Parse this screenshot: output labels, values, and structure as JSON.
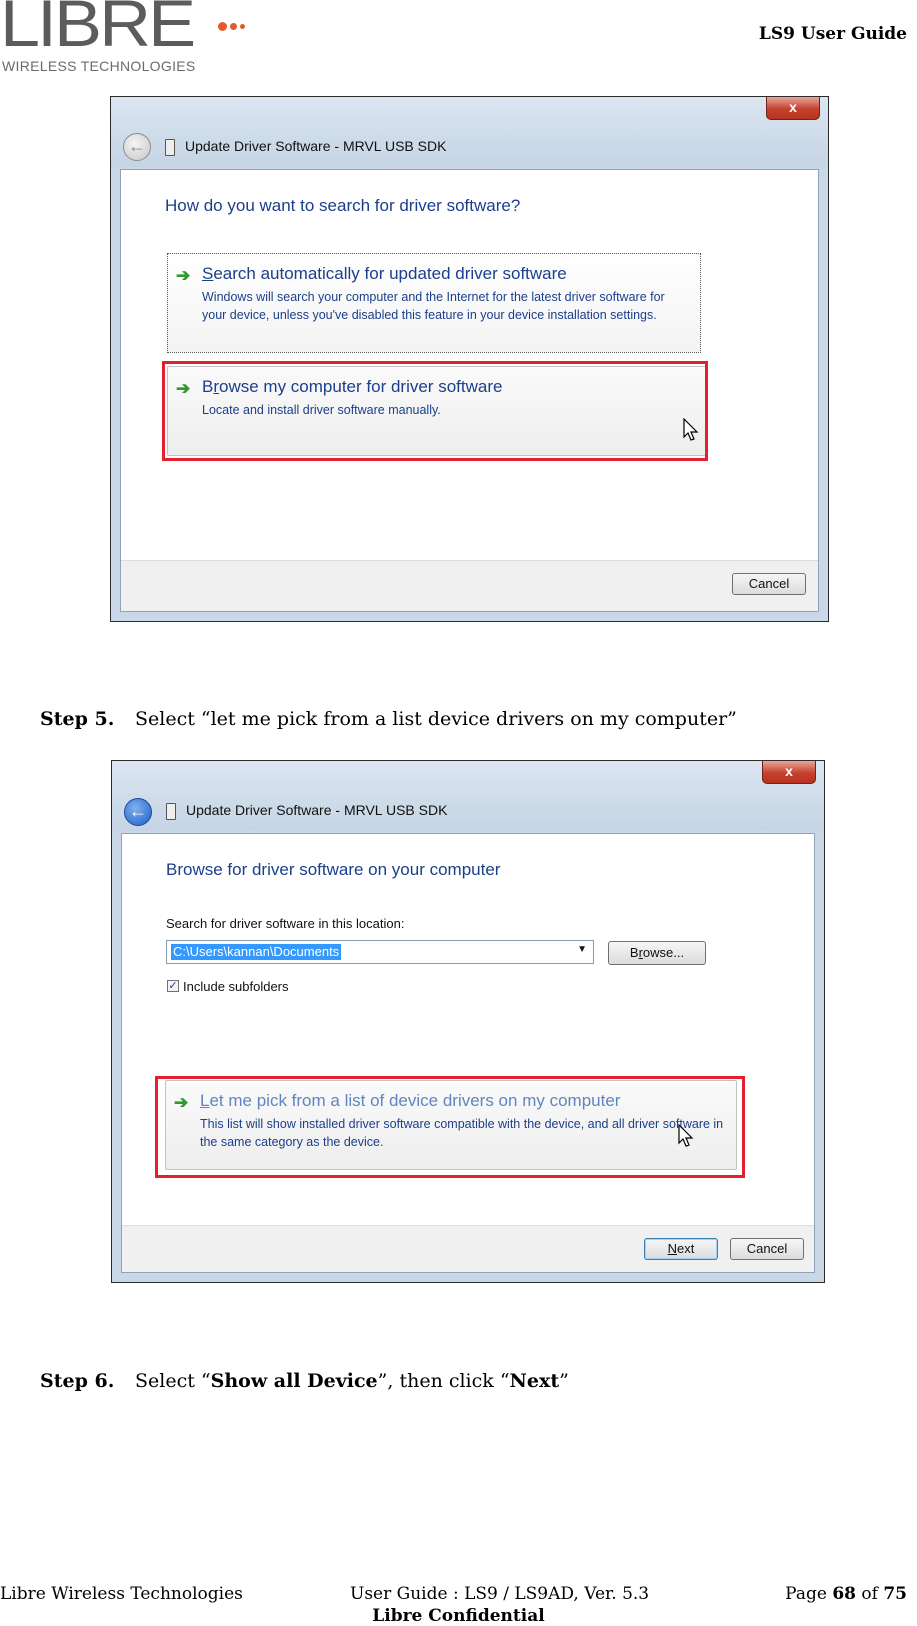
{
  "header": {
    "logo_word": "LIBRE",
    "logo_sub": "WIRELESS TECHNOLOGIES",
    "doc_title": "LS9 User Guide"
  },
  "dialog1": {
    "title": "Update Driver Software - MRVL USB SDK",
    "close_label": "x",
    "heading": "How do you want to search for driver software?",
    "option1": {
      "title_first": "S",
      "title_rest": "earch automatically for updated driver software",
      "desc": "Windows will search your computer and the Internet for the latest driver software for your device, unless you've disabled this feature in your device installation settings."
    },
    "option2": {
      "title_first": "B",
      "title_u": "r",
      "title_rest": "owse my computer for driver software",
      "desc": "Locate and install driver software manually."
    },
    "cancel_label": "Cancel"
  },
  "step5": {
    "number": "Step 5.",
    "text": "Select “let me pick from a list device drivers on my computer”"
  },
  "dialog2": {
    "title": "Update Driver Software - MRVL USB SDK",
    "close_label": "x",
    "heading": "Browse for driver software on your computer",
    "location_label": "Search for driver software in this location:",
    "location_value": "C:\\Users\\kannan\\Documents",
    "browse_first": "B",
    "browse_u": "r",
    "browse_rest": "owse...",
    "include_subfolders": "Include subfolders",
    "option": {
      "title_u": "L",
      "title_rest": "et me pick from a list of device drivers on my computer",
      "desc": "This list will show installed driver software compatible with the device, and all driver software in the same category as the device."
    },
    "next_u": "N",
    "next_rest": "ext",
    "cancel_label": "Cancel"
  },
  "step6": {
    "number": "Step 6.",
    "text_before": "Select “",
    "bold1": "Show all Device",
    "text_mid": "”, then click “",
    "bold2": "Next",
    "text_after": "”"
  },
  "footer": {
    "company": "Libre Wireless Technologies",
    "guide": "User Guide : LS9 / LS9AD, Ver. 5.3",
    "page_label": "Page",
    "page_num": "68",
    "page_of": "of",
    "page_total": "75",
    "confidential": "Libre Confidential"
  },
  "colors": {
    "link_blue": "#1b3f8b",
    "highlight_red": "#e3202e",
    "logo_orange": "#e35a2a"
  }
}
